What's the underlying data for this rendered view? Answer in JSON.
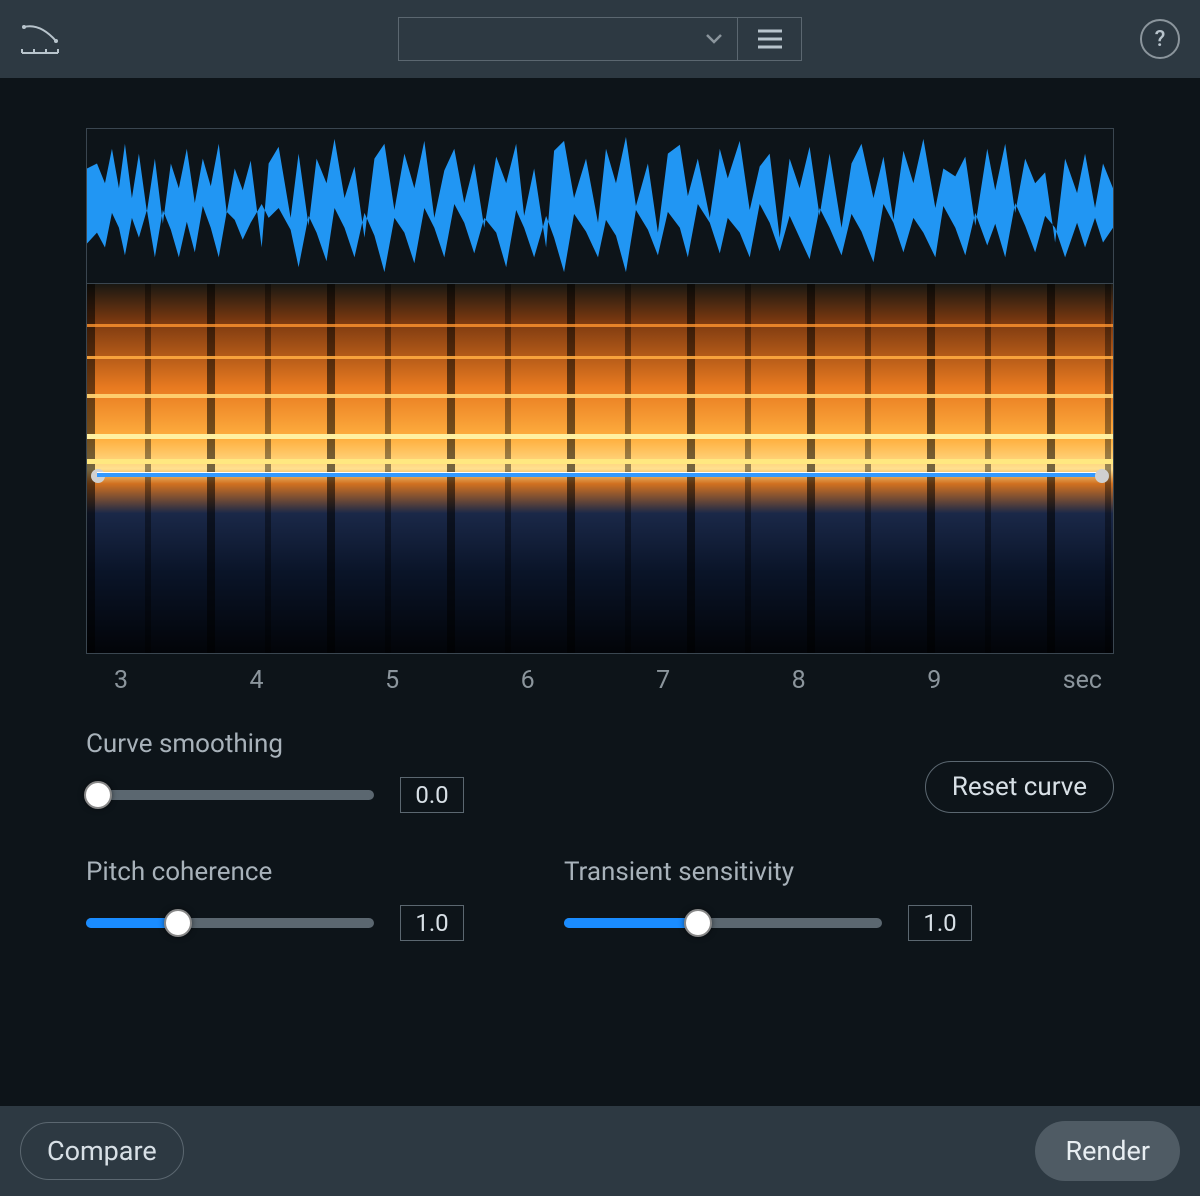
{
  "header": {
    "preset_value": "",
    "help_label": "?"
  },
  "timeline": {
    "ticks": [
      "3",
      "4",
      "5",
      "6",
      "7",
      "8",
      "9",
      "sec"
    ]
  },
  "sliders": {
    "curve_smoothing": {
      "label": "Curve smoothing",
      "value": "0.0",
      "fill_pct": 0,
      "thumb_pct": 4
    },
    "pitch_coherence": {
      "label": "Pitch coherence",
      "value": "1.0",
      "fill_pct": 32,
      "thumb_pct": 32
    },
    "transient_sensitivity": {
      "label": "Transient sensitivity",
      "value": "1.0",
      "fill_pct": 42,
      "thumb_pct": 42
    }
  },
  "buttons": {
    "reset_curve": "Reset curve",
    "compare": "Compare",
    "render": "Render"
  }
}
